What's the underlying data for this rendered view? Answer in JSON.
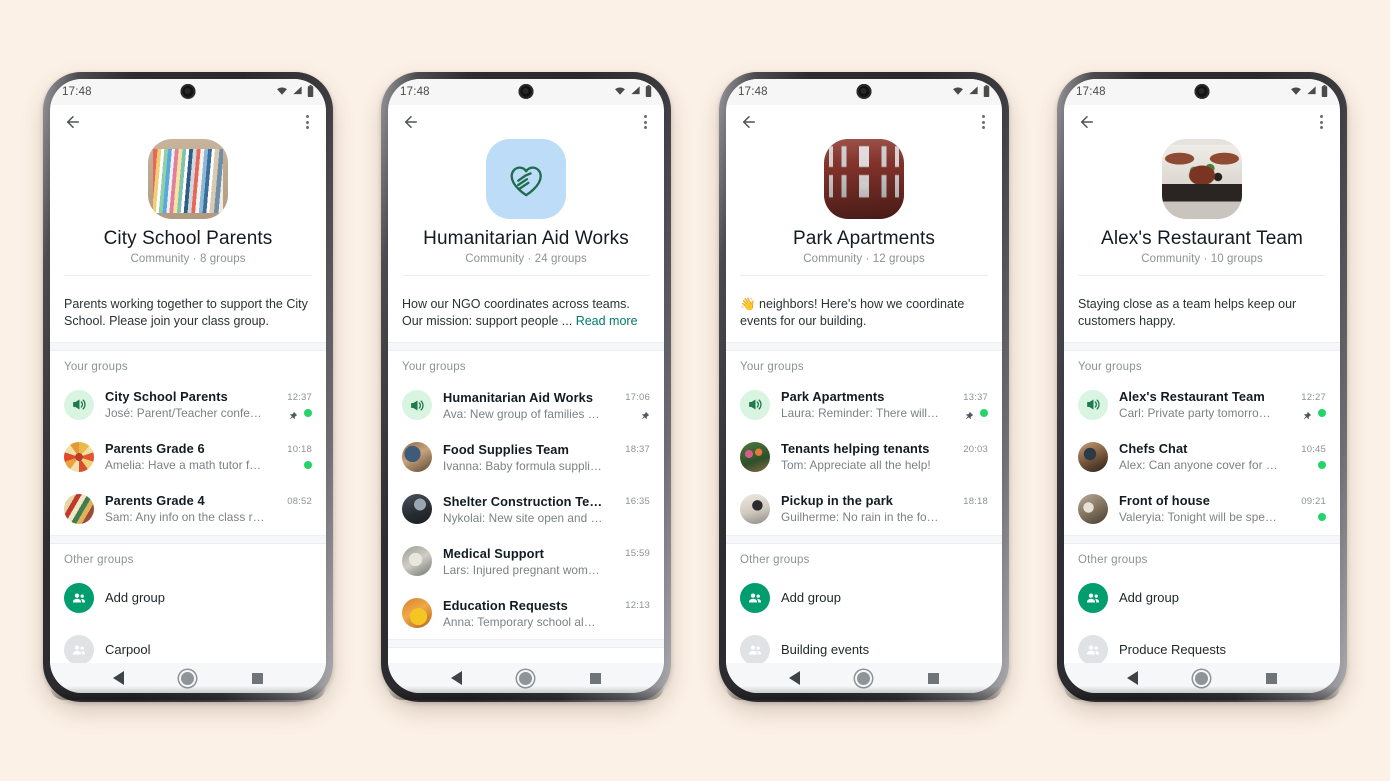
{
  "background_color": "#FCF1E6",
  "accent_green": "#009e6f",
  "link_green": "#027a6c",
  "unread_dot_green": "#25d366",
  "status_bar": {
    "time": "17:48",
    "icons": [
      "wifi-icon",
      "cellular-signal-icon",
      "battery-icon"
    ]
  },
  "nav_bar": {
    "back": "nav-back-triangle",
    "home": "nav-home-circle",
    "recents": "nav-recents-square"
  },
  "section_labels": {
    "your_groups": "Your groups",
    "other_groups": "Other groups"
  },
  "read_more_label": "Read more",
  "phones": [
    {
      "id": "city-school-parents",
      "avatar_art": "books",
      "name": "City School Parents",
      "subtitle": "Community · 8 groups",
      "description": "Parents working together to support the City School. Please join your class group.",
      "description_emoji": "",
      "has_read_more": false,
      "your_groups": [
        {
          "avatar": "announce",
          "title": "City School Parents",
          "preview": "José: Parent/Teacher conferen…",
          "time": "12:37",
          "pinned": true,
          "unread": true
        },
        {
          "avatar": "a-flower",
          "title": "Parents Grade 6",
          "preview": "Amelia: Have a math tutor for the…",
          "time": "10:18",
          "pinned": false,
          "unread": true
        },
        {
          "avatar": "a-crowd",
          "title": "Parents Grade 4",
          "preview": "Sam: Any info on the class recital?",
          "time": "08:52",
          "pinned": false,
          "unread": false
        }
      ],
      "other_groups": [
        {
          "icon": "add-group-icon",
          "label": "Add group",
          "style": "green"
        },
        {
          "icon": "group-icon",
          "label": "Carpool",
          "style": "gray"
        }
      ]
    },
    {
      "id": "humanitarian-aid-works",
      "avatar_art": "hands",
      "name": "Humanitarian Aid Works",
      "subtitle": "Community · 24 groups",
      "description": "How our NGO coordinates across teams. Our mission: support people ...",
      "description_emoji": "",
      "has_read_more": true,
      "your_groups": [
        {
          "avatar": "announce",
          "title": "Humanitarian Aid Works",
          "preview": "Ava: New group of families waitin…",
          "time": "17:06",
          "pinned": true,
          "unread": false
        },
        {
          "avatar": "a-food2",
          "title": "Food Supplies Team",
          "preview": "Ivanna: Baby formula supplies running …",
          "time": "18:37",
          "pinned": false,
          "unread": false
        },
        {
          "avatar": "a-dark",
          "title": "Shelter Construction Team",
          "preview": "Nykolai: New site open and ready for …",
          "time": "16:35",
          "pinned": false,
          "unread": false
        },
        {
          "avatar": "a-medical",
          "title": "Medical Support",
          "preview": "Lars: Injured pregnant woman in need…",
          "time": "15:59",
          "pinned": false,
          "unread": false
        },
        {
          "avatar": "a-yellow",
          "title": "Education Requests",
          "preview": "Anna: Temporary school almost comp…",
          "time": "12:13",
          "pinned": false,
          "unread": false
        }
      ],
      "other_groups": []
    },
    {
      "id": "park-apartments",
      "avatar_art": "building",
      "name": "Park Apartments",
      "subtitle": "Community · 12 groups",
      "description": "neighbors! Here's how we coordinate events for our building.",
      "description_emoji": "👋",
      "has_read_more": false,
      "your_groups": [
        {
          "avatar": "announce",
          "title": "Park Apartments",
          "preview": "Laura: Reminder: There will be…",
          "time": "13:37",
          "pinned": true,
          "unread": true
        },
        {
          "avatar": "a-plants",
          "title": "Tenants helping tenants",
          "preview": "Tom: Appreciate all the help!",
          "time": "20:03",
          "pinned": false,
          "unread": false
        },
        {
          "avatar": "a-dog",
          "title": "Pickup in the park",
          "preview": "Guilherme: No rain in the forecast!",
          "time": "18:18",
          "pinned": false,
          "unread": false
        }
      ],
      "other_groups": [
        {
          "icon": "add-group-icon",
          "label": "Add group",
          "style": "green"
        },
        {
          "icon": "group-icon",
          "label": "Building events",
          "style": "gray"
        }
      ]
    },
    {
      "id": "alexs-restaurant-team",
      "avatar_art": "food",
      "name": "Alex's Restaurant Team",
      "subtitle": "Community · 10 groups",
      "description": "Staying close as a team helps keep our customers happy.",
      "description_emoji": "",
      "has_read_more": false,
      "your_groups": [
        {
          "avatar": "announce",
          "title": "Alex's Restaurant Team",
          "preview": "Carl: Private party tomorrow in…",
          "time": "12:27",
          "pinned": true,
          "unread": true
        },
        {
          "avatar": "a-chefs",
          "title": "Chefs Chat",
          "preview": "Alex: Can anyone cover for me?",
          "time": "10:45",
          "pinned": false,
          "unread": true
        },
        {
          "avatar": "a-foh",
          "title": "Front of house",
          "preview": "Valeryia: Tonight will be special!",
          "time": "09:21",
          "pinned": false,
          "unread": true
        }
      ],
      "other_groups": [
        {
          "icon": "add-group-icon",
          "label": "Add group",
          "style": "green"
        },
        {
          "icon": "group-icon",
          "label": "Produce Requests",
          "style": "gray"
        }
      ]
    }
  ]
}
